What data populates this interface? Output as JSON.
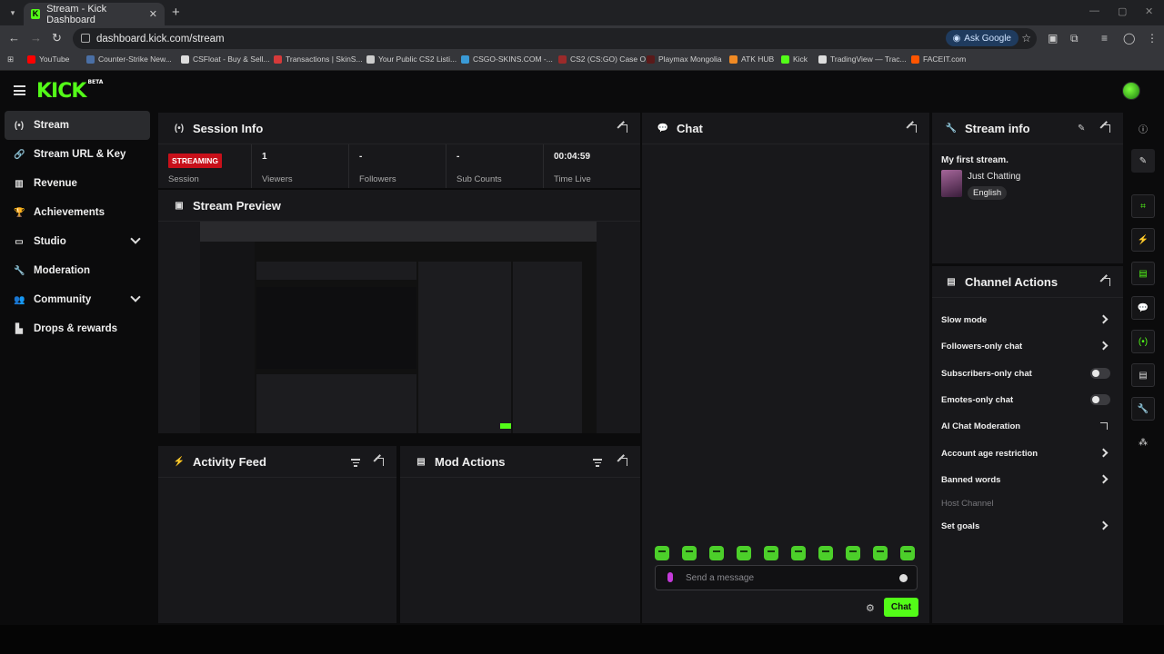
{
  "browser": {
    "tab_title": "Stream - Kick Dashboard",
    "url": "dashboard.kick.com/stream",
    "ask_google": "Ask Google",
    "bookmarks": [
      {
        "label": "YouTube",
        "color": "#ff0000"
      },
      {
        "label": "Counter-Strike New...",
        "color": "#4a6fa5"
      },
      {
        "label": "CSFloat - Buy & Sell...",
        "color": "#dddddd"
      },
      {
        "label": "Transactions | SkinS...",
        "color": "#d63a3a"
      },
      {
        "label": "Your Public CS2 Listi...",
        "color": "#cccccc"
      },
      {
        "label": "CSGO-SKINS.COM -...",
        "color": "#3a9ad6"
      },
      {
        "label": "CS2 (CS:GO) Case O...",
        "color": "#9b2a2a"
      },
      {
        "label": "Playmax Mongolia",
        "color": "#5a1a1a"
      },
      {
        "label": "ATK HUB",
        "color": "#f08a24"
      },
      {
        "label": "Kick",
        "color": "#53fc18"
      },
      {
        "label": "TradingView — Trac...",
        "color": "#dddddd"
      },
      {
        "label": "FACEIT.com",
        "color": "#ff5500"
      }
    ]
  },
  "app": {
    "logo": "KICK",
    "logo_badge": "BETA",
    "accent": "#53fc18"
  },
  "sidebar": {
    "items": [
      {
        "label": "Stream",
        "icon": "broadcast-icon",
        "glyph": "(•)"
      },
      {
        "label": "Stream URL & Key",
        "icon": "link-icon",
        "glyph": "🔗"
      },
      {
        "label": "Revenue",
        "icon": "chart-icon",
        "glyph": "▥"
      },
      {
        "label": "Achievements",
        "icon": "trophy-icon",
        "glyph": "🏆"
      },
      {
        "label": "Studio",
        "icon": "studio-icon",
        "glyph": "▭"
      },
      {
        "label": "Moderation",
        "icon": "wrench-icon",
        "glyph": "🔧"
      },
      {
        "label": "Community",
        "icon": "community-icon",
        "glyph": "👥"
      },
      {
        "label": "Drops & rewards",
        "icon": "drops-icon",
        "glyph": "▙"
      }
    ]
  },
  "session": {
    "title": "Session Info",
    "status": "STREAMING",
    "status_label": "Session",
    "stats": [
      {
        "value": "1",
        "label": "Viewers"
      },
      {
        "value": "-",
        "label": "Followers"
      },
      {
        "value": "-",
        "label": "Sub Counts"
      },
      {
        "value": "00:04:59",
        "label": "Time Live"
      }
    ]
  },
  "preview": {
    "title": "Stream Preview"
  },
  "activity": {
    "title": "Activity Feed"
  },
  "mod_actions": {
    "title": "Mod Actions"
  },
  "chat": {
    "title": "Chat",
    "placeholder": "Send a message",
    "send_label": "Chat"
  },
  "stream_info": {
    "title": "Stream info",
    "stream_title": "My first stream.",
    "category": "Just Chatting",
    "language": "English"
  },
  "channel_actions": {
    "title": "Channel Actions",
    "items": [
      {
        "label": "Slow mode",
        "control": "chevron"
      },
      {
        "label": "Followers-only chat",
        "control": "chevron"
      },
      {
        "label": "Subscribers-only chat",
        "control": "toggle"
      },
      {
        "label": "Emotes-only chat",
        "control": "toggle"
      },
      {
        "label": "AI Chat Moderation",
        "control": "external"
      },
      {
        "label": "Account age restriction",
        "control": "chevron"
      },
      {
        "label": "Banned words",
        "control": "chevron"
      },
      {
        "label": "Host Channel",
        "control": "disabled"
      },
      {
        "label": "Set goals",
        "control": "chevron"
      }
    ]
  }
}
